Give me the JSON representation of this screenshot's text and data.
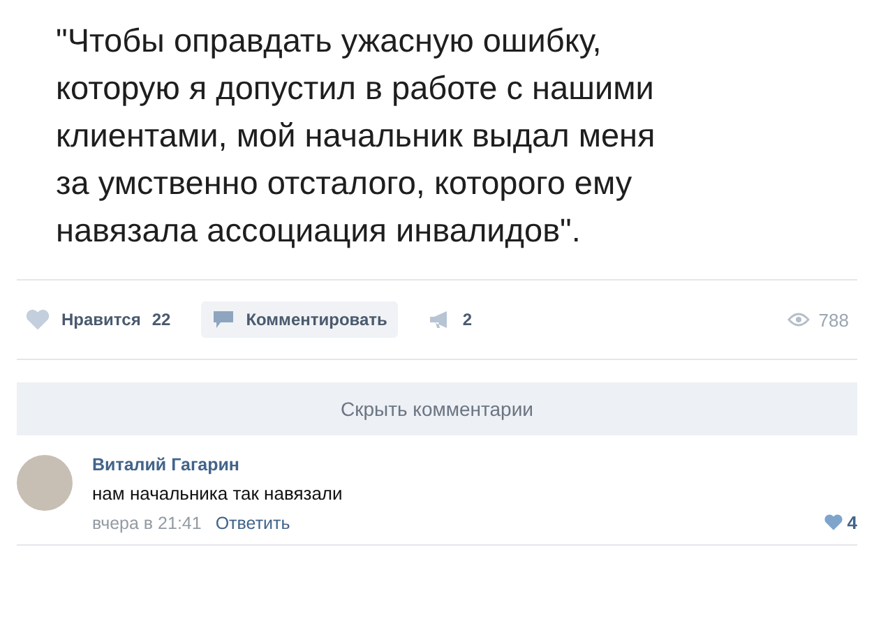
{
  "post": {
    "text_lines": [
      "\"Чтобы оправдать ужасную ошибку,",
      "которую я допустил в работе с нашими",
      "клиентами, мой начальник выдал меня",
      "за умственно отсталого, которого ему",
      "навязала ассоциация инвалидов\"."
    ]
  },
  "actions": {
    "like": {
      "label": "Нравится",
      "count": "22",
      "liked": false
    },
    "comment": {
      "label": "Комментировать"
    },
    "share": {
      "count": "2"
    },
    "views": {
      "count": "788"
    }
  },
  "hide_comments": {
    "label": "Скрыть комментарии"
  },
  "comments": [
    {
      "author": "Виталий Гагарин",
      "text": "нам начальника так навязали",
      "time": "вчера в 21:41",
      "reply": "Ответить",
      "likes": "4",
      "liked": true
    }
  ]
}
